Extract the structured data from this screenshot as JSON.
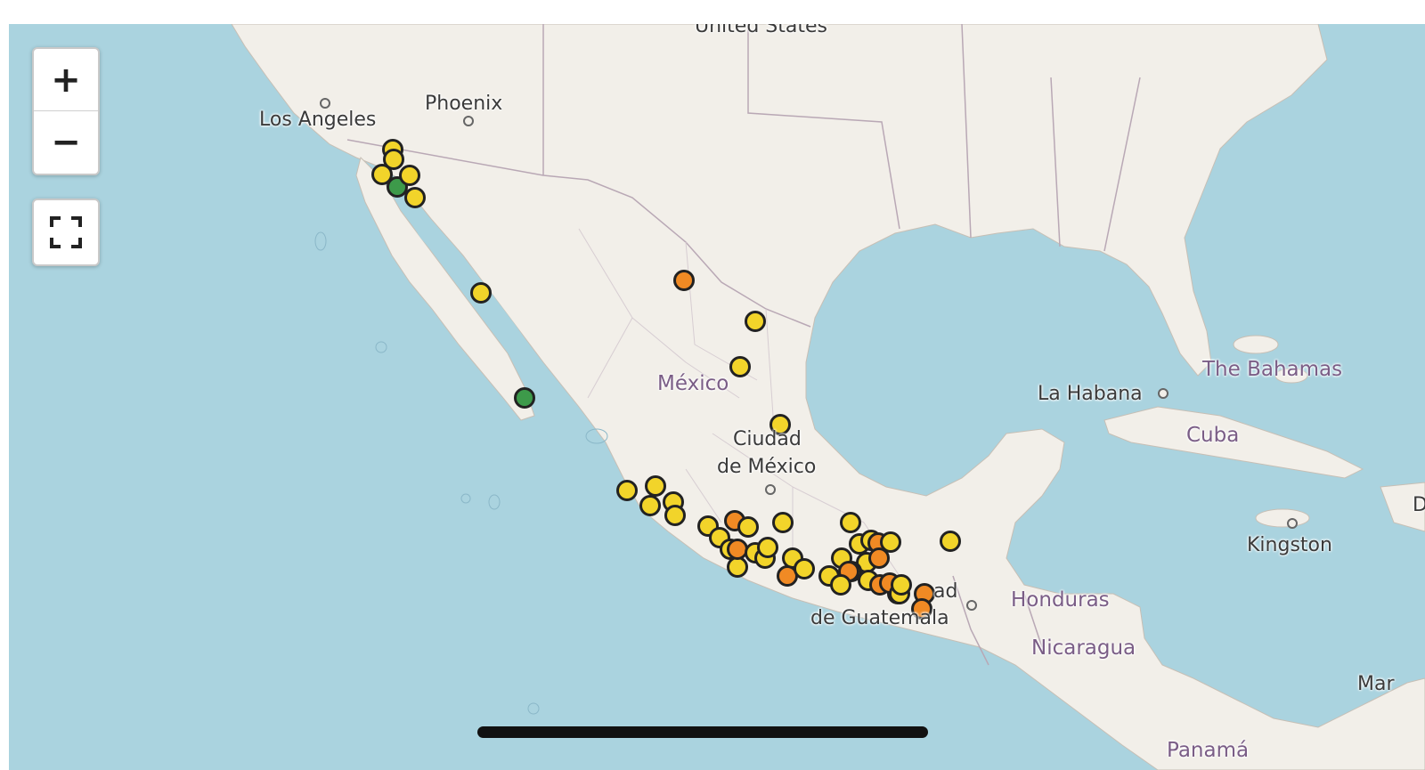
{
  "map": {
    "controls": {
      "zoom_in": "+",
      "zoom_out": "−"
    },
    "colors": {
      "water": "#aad3df",
      "land": "#f2efe9",
      "border": "#b9a8b5",
      "marker_yellow": "#f2d42a",
      "marker_orange": "#f08a24",
      "marker_green": "#3d9a4a",
      "marker_stroke": "#222222"
    },
    "labels": {
      "united_states": "United States",
      "los_angeles": "Los Angeles",
      "phoenix": "Phoenix",
      "mexico": "México",
      "ciudad": "Ciudad",
      "de_mexico": "de México",
      "la_habana": "La Habana",
      "the_bahamas": "The Bahamas",
      "cuba": "Cuba",
      "kingston": "Kingston",
      "honduras": "Honduras",
      "nicaragua": "Nicaragua",
      "ad": "ad",
      "de_guatemala": "de Guatemala",
      "panama": "Panamá",
      "mar": "Mar",
      "d": "D"
    },
    "markers": [
      {
        "color": "yellow"
      },
      {
        "color": "yellow"
      },
      {
        "color": "yellow"
      },
      {
        "color": "green"
      },
      {
        "color": "yellow"
      },
      {
        "color": "yellow"
      },
      {
        "color": "yellow"
      },
      {
        "color": "green"
      },
      {
        "color": "orange"
      },
      {
        "color": "yellow"
      },
      {
        "color": "yellow"
      },
      {
        "color": "yellow"
      },
      {
        "color": "yellow"
      },
      {
        "color": "yellow"
      },
      {
        "color": "yellow"
      },
      {
        "color": "yellow"
      },
      {
        "color": "yellow"
      },
      {
        "color": "yellow"
      },
      {
        "color": "yellow"
      },
      {
        "color": "yellow"
      },
      {
        "color": "orange"
      },
      {
        "color": "yellow"
      },
      {
        "color": "yellow"
      },
      {
        "color": "yellow"
      },
      {
        "color": "orange"
      },
      {
        "color": "yellow"
      },
      {
        "color": "yellow"
      },
      {
        "color": "yellow"
      },
      {
        "color": "yellow"
      },
      {
        "color": "orange"
      },
      {
        "color": "yellow"
      },
      {
        "color": "yellow"
      },
      {
        "color": "yellow"
      },
      {
        "color": "yellow"
      },
      {
        "color": "yellow"
      },
      {
        "color": "yellow"
      },
      {
        "color": "yellow"
      },
      {
        "color": "orange"
      },
      {
        "color": "yellow"
      },
      {
        "color": "orange"
      },
      {
        "color": "yellow"
      },
      {
        "color": "orange"
      },
      {
        "color": "yellow"
      },
      {
        "color": "orange"
      },
      {
        "color": "yellow"
      },
      {
        "color": "orange"
      },
      {
        "color": "yellow"
      },
      {
        "color": "yellow"
      },
      {
        "color": "orange"
      },
      {
        "color": "orange"
      },
      {
        "color": "yellow"
      },
      {
        "color": "yellow"
      }
    ]
  }
}
